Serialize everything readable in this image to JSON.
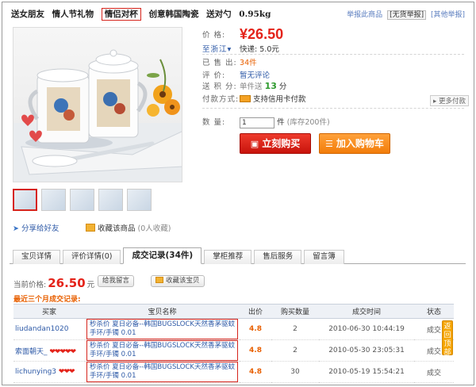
{
  "title": {
    "pre": [
      "送女朋友",
      "情人节礼物"
    ],
    "highlight": "情侣对杯",
    "post": [
      "创意韩国陶瓷",
      "送对勺",
      "0.95kg"
    ]
  },
  "report": {
    "text": "举报此商品",
    "option": "[无货举报]",
    "link": "[其他举报]"
  },
  "info": {
    "price_label": "价  格:",
    "price": "¥26.50",
    "ship_label": "至浙江",
    "ship_value": "快递: 5.0元",
    "sold_label": "已 售 出:",
    "sold_value": "34件",
    "rate_label": "评  价:",
    "rate_value": "暂无评论",
    "points_label": "送 积 分:",
    "points_pre": "单件送",
    "points_value": "13",
    "points_unit": "分",
    "pay_label": "付款方式:",
    "pay_value": "支持信用卡付款",
    "pay_more": "▸ 更多付款",
    "qty_label": "数  量:",
    "qty_value": "1",
    "qty_unit": "件",
    "stock": "(库存200件)"
  },
  "buttons": {
    "buy": "立刻购买",
    "cart": "加入购物车"
  },
  "share": {
    "label": "分享给好友",
    "collect": "收藏该商品",
    "collect_count": "(0人收藏)"
  },
  "tabs": [
    "宝贝详情",
    "评价详情(0)",
    "成交记录(34件)",
    "掌柜推荐",
    "售后服务",
    "留言簿"
  ],
  "active_tab": 2,
  "record": {
    "cur_label": "当前价格:",
    "cur_value": "26.50",
    "cur_unit": "元",
    "btn_buy": "给我留言",
    "btn_collect": "收藏该宝贝",
    "recent_title": "最近三个月成交记录:"
  },
  "table": {
    "headers": [
      "买家",
      "宝贝名称",
      "出价",
      "购买数量",
      "成交时间",
      "状态"
    ],
    "rows": [
      {
        "buyer": "liudandan1020",
        "hearts": "",
        "product": "秒杀价 夏日必备--韩国BUGSLOCK天然香茅驱蚊手环/手镯 0.01",
        "bid": "4.8",
        "qty": "2",
        "time": "2010-06-30 10:44:19",
        "status": "成交"
      },
      {
        "buyer": "索面朝天_",
        "hearts": "❤❤❤❤❤",
        "product": "秒杀价 夏日必备--韩国BUGSLOCK天然香茅驱蚊手环/手镯 0.01",
        "bid": "4.8",
        "qty": "2",
        "time": "2010-05-30 23:05:31",
        "status": "成交"
      },
      {
        "buyer": "lichunying3",
        "hearts": "❤❤❤",
        "product": "秒杀价 夏日必备--韩国BUGSLOCK天然香茅驱蚊手环/手镯 0.01",
        "bid": "4.8",
        "qty": "30",
        "time": "2010-05-19 15:54:21",
        "status": "成交"
      }
    ]
  },
  "scroll_tab": "返回顶部",
  "colors": {
    "accent": "#e4231a",
    "link": "#2e5aa7",
    "orange": "#e85f00"
  }
}
